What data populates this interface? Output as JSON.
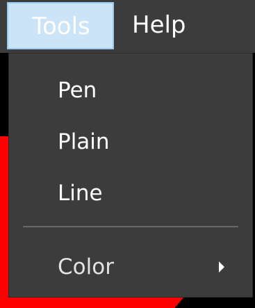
{
  "menubar": {
    "items": [
      {
        "label": "Tools",
        "state": "open"
      },
      {
        "label": "Help"
      }
    ]
  },
  "tools_menu": {
    "items": [
      {
        "label": "Pen"
      },
      {
        "label": "Plain"
      },
      {
        "label": "Line"
      },
      {
        "label": "Color",
        "has_submenu": true,
        "icon": "submenu-arrow"
      }
    ]
  },
  "colors": {
    "menu_background": "#3c3c3c",
    "selected_menu_highlight": "#cce4f7",
    "canvas_stroke": "#ff0000"
  }
}
